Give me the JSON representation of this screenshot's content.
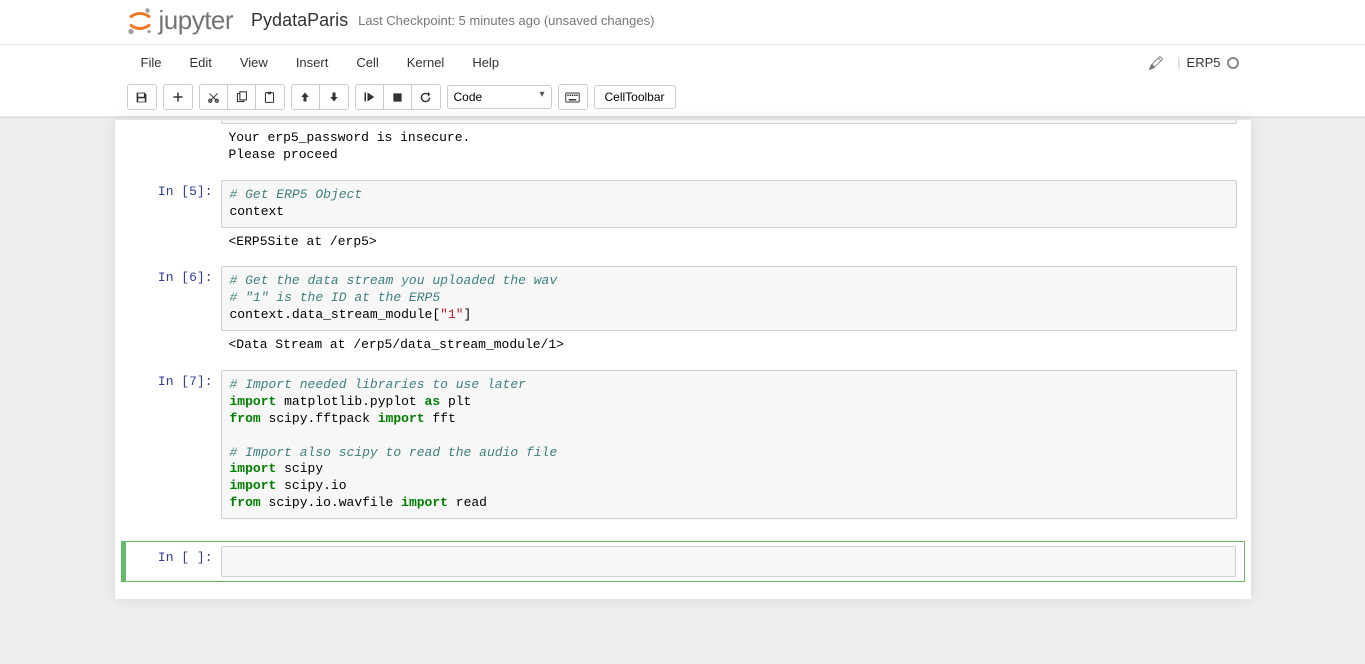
{
  "header": {
    "logo_text": "jupyter",
    "notebook_name": "PydataParis",
    "checkpoint": "Last Checkpoint: 5 minutes ago (unsaved changes)"
  },
  "menu": {
    "items": [
      "File",
      "Edit",
      "View",
      "Insert",
      "Cell",
      "Kernel",
      "Help"
    ],
    "kernel_name": "ERP5"
  },
  "toolbar": {
    "cell_type": "Code",
    "celltoolbar_label": "CellToolbar"
  },
  "cells": [
    {
      "type": "output_only",
      "output": "Your erp5_password is insecure.\nPlease proceed"
    },
    {
      "type": "code",
      "prompt_num": "5",
      "input_pre": "",
      "comment1": "# Get ERP5 Object",
      "code_line": "context",
      "output": "<ERP5Site at /erp5>"
    },
    {
      "type": "code",
      "prompt_num": "6",
      "comment1": "# Get the data stream you uploaded the wav",
      "comment2": "# \"1\" is the ID at the ERP5",
      "code_line": "context.data_stream_module[",
      "code_str": "\"1\"",
      "code_tail": "]",
      "output": "<Data Stream at /erp5/data_stream_module/1>"
    },
    {
      "type": "code",
      "prompt_num": "7",
      "comment1": "# Import needed libraries to use later",
      "line2_kw1": "import",
      "line2_rest": " matplotlib.pyplot ",
      "line2_kw2": "as",
      "line2_tail": " plt",
      "line3_kw1": "from",
      "line3_mid": " scipy.fftpack ",
      "line3_kw2": "import",
      "line3_tail": " fft",
      "comment2": "# Import also scipy to read the audio file",
      "line5_kw": "import",
      "line5_tail": " scipy",
      "line6_kw": "import",
      "line6_tail": " scipy.io",
      "line7_kw1": "from",
      "line7_mid": " scipy.io.wavfile ",
      "line7_kw2": "import",
      "line7_tail": " read"
    },
    {
      "type": "empty",
      "prompt_num": " "
    }
  ],
  "prompts": {
    "in_label_5": "In [5]:",
    "in_label_6": "In [6]:",
    "in_label_7": "In [7]:",
    "in_label_empty": "In [ ]:"
  }
}
